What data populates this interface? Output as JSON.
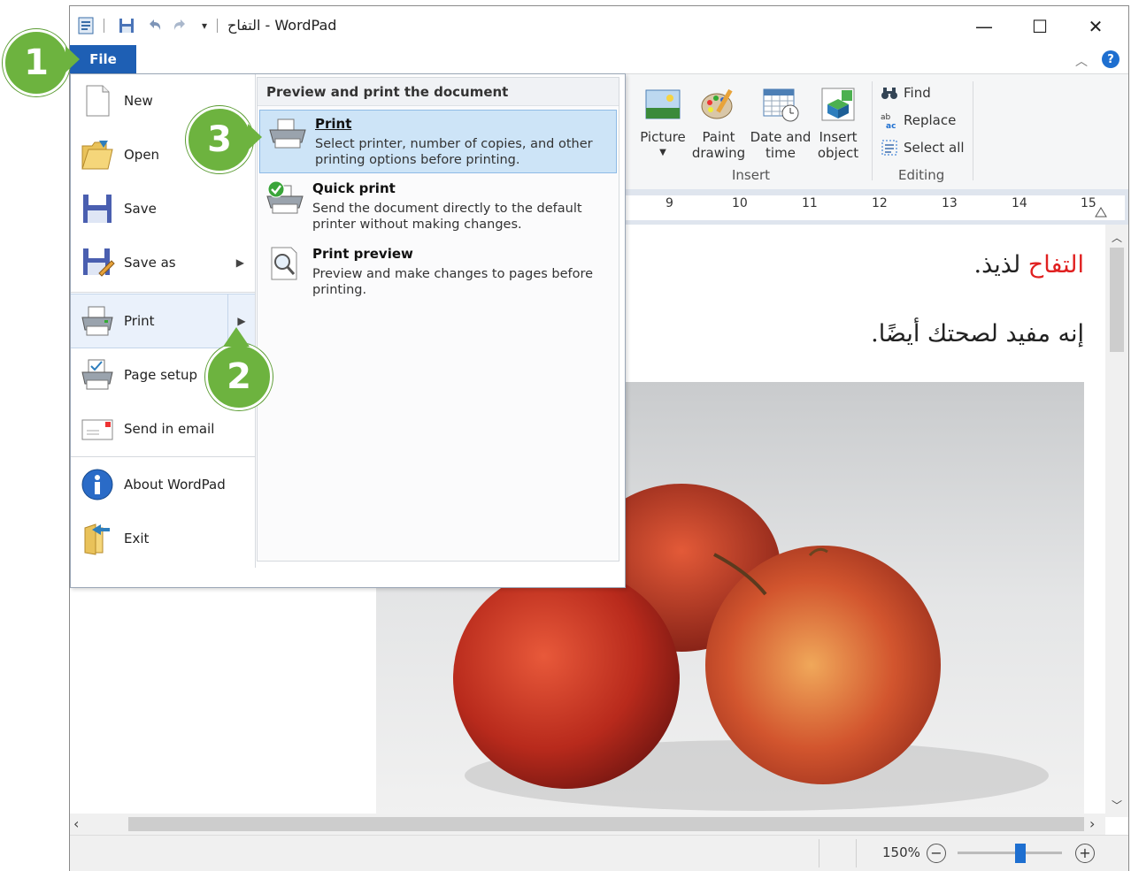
{
  "window": {
    "title": "التفاح - WordPad",
    "controls": {
      "minimize": "—",
      "maximize": "☐",
      "close": "✕"
    }
  },
  "ribbon": {
    "file_tab": "File",
    "insert": {
      "picture": "Picture",
      "paint_drawing_1": "Paint",
      "paint_drawing_2": "drawing",
      "date_time_1": "Date and",
      "date_time_2": "time",
      "insert_object_1": "Insert",
      "insert_object_2": "object",
      "group_label": "Insert"
    },
    "editing": {
      "find": "Find",
      "replace": "Replace",
      "select_all": "Select all",
      "group_label": "Editing"
    }
  },
  "ruler": {
    "ticks": [
      "9",
      "10",
      "11",
      "12",
      "13",
      "14",
      "15"
    ]
  },
  "file_menu": {
    "items": [
      {
        "label": "New",
        "icon": "new-document-icon"
      },
      {
        "label": "Open",
        "icon": "open-folder-icon"
      },
      {
        "label": "Save",
        "icon": "save-icon"
      },
      {
        "label": "Save as",
        "icon": "save-as-icon",
        "has_submenu": true
      },
      {
        "label": "Print",
        "icon": "printer-icon",
        "has_submenu": true,
        "selected": true
      },
      {
        "label": "Page setup",
        "icon": "page-setup-icon"
      },
      {
        "label": "Send in email",
        "icon": "email-icon"
      },
      {
        "label": "About WordPad",
        "icon": "info-icon"
      },
      {
        "label": "Exit",
        "icon": "exit-icon"
      }
    ],
    "submenu": {
      "title": "Preview and print the document",
      "items": [
        {
          "title": "Print",
          "desc": "Select printer, number of copies, and other printing options before printing.",
          "highlighted": true
        },
        {
          "title": "Quick print",
          "desc": "Send the document directly to the default printer without making changes."
        },
        {
          "title": "Print preview",
          "desc": "Preview and make changes to pages before printing."
        }
      ]
    }
  },
  "document": {
    "line1_red": "التفاح",
    "line1_rest": " لذيذ.",
    "line2": "إنه مفيد لصحتك أيضًا."
  },
  "status": {
    "zoom": "150%",
    "zoom_level_percent": 60
  },
  "badges": {
    "one": "1",
    "two": "2",
    "three": "3"
  },
  "colors": {
    "file_tab": "#1e5fb4",
    "badge": "#6db33f",
    "arabic_red": "#e02020",
    "highlight": "#cde4f7"
  }
}
